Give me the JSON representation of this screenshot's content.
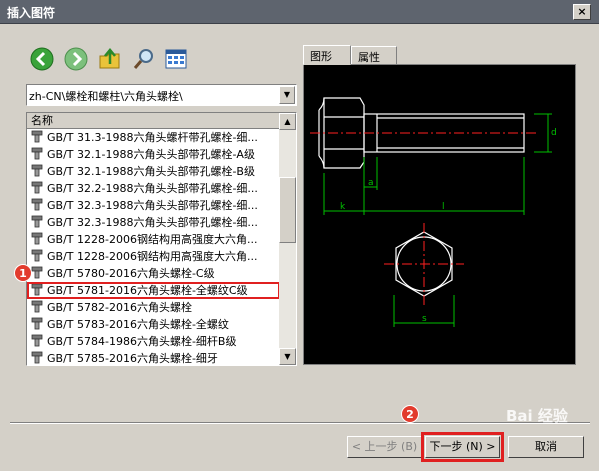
{
  "window": {
    "title": "插入图符",
    "close_label": "×"
  },
  "toolbar": {
    "buttons": [
      {
        "name": "back-button",
        "icon": "arrow-left-icon"
      },
      {
        "name": "forward-button",
        "icon": "arrow-right-icon"
      },
      {
        "name": "up-folder-button",
        "icon": "folder-up-icon"
      },
      {
        "name": "search-button",
        "icon": "magnifier-icon"
      },
      {
        "name": "view-button",
        "icon": "grid-view-icon"
      }
    ]
  },
  "path": {
    "value": "zh-CN\\螺栓和螺柱\\六角头螺栓\\"
  },
  "list": {
    "header": "名称",
    "items": [
      "GB/T 31.3-1988六角头螺杆带孔螺栓-细...",
      "GB/T 32.1-1988六角头头部带孔螺栓-A级",
      "GB/T 32.1-1988六角头头部带孔螺栓-B级",
      "GB/T 32.2-1988六角头头部带孔螺栓-细...",
      "GB/T 32.3-1988六角头头部带孔螺栓-细...",
      "GB/T 32.3-1988六角头头部带孔螺栓-细...",
      "GB/T 1228-2006钢结构用高强度大六角...",
      "GB/T 1228-2006钢结构用高强度大六角...",
      "GB/T 5780-2016六角头螺栓-C级",
      "GB/T 5781-2016六角头螺栓-全螺纹C级",
      "GB/T 5782-2016六角头螺栓",
      "GB/T 5783-2016六角头螺栓-全螺纹",
      "GB/T 5784-1986六角头螺栓-细杆B级",
      "GB/T 5785-2016六角头螺栓-细牙"
    ],
    "selected_index": 9
  },
  "tabs": [
    {
      "label": "图形"
    },
    {
      "label": "属性"
    }
  ],
  "preview": {
    "labels": {
      "d": "d",
      "a": "a",
      "k": "k",
      "l": "l",
      "s": "s"
    }
  },
  "buttons": {
    "prev": "< 上一步 (B)",
    "next": "下一步 (N) >",
    "cancel": "取消"
  },
  "annotations": {
    "badge1": "1",
    "badge2": "2"
  },
  "watermark": "Bai 经验",
  "colors": {
    "highlight": "#e02020",
    "badge": "#e23b2d",
    "cad_green": "#00c000",
    "cad_red": "#ff2020"
  }
}
